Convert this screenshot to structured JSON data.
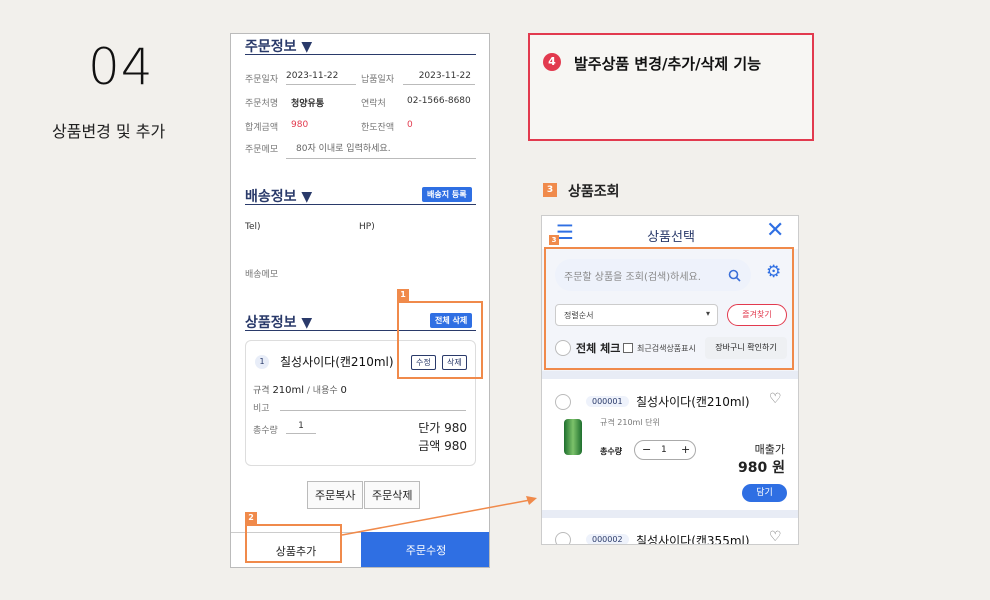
{
  "step": {
    "number": "04",
    "title": "상품변경 및 추가"
  },
  "left": {
    "order_info": {
      "title": "주문정보 ▼",
      "order_date_label": "주문일자",
      "order_date": "2023-11-22",
      "delivery_date_label": "납품일자",
      "delivery_date": "2023-11-22",
      "customer_label": "주문처명",
      "customer": "청양유통",
      "contact_label": "연락처",
      "contact": "02-1566-8680",
      "total_label": "합계금액",
      "total": "980",
      "limit_label": "한도잔액",
      "limit": "0",
      "memo_label": "주문메모",
      "memo_placeholder": "80자 이내로 입력하세요."
    },
    "shipping": {
      "title": "배송정보 ▼",
      "register_button": "배송지 등록",
      "tel_label": "Tel)",
      "hp_label": "HP)",
      "memo_label": "배송메모"
    },
    "products": {
      "title": "상품정보 ▼",
      "delete_all_button": "전체 삭제",
      "item": {
        "index": "1",
        "name": "칠성사이다(캔210ml)",
        "edit_button": "수정",
        "delete_button": "삭제",
        "spec_label": "규격",
        "spec_value": "210ml",
        "unit_sep": " / 내용수",
        "unit_value": "0",
        "note_label": "비고",
        "qty_label": "총수량",
        "qty_value": "1",
        "unit_price": "단가 980",
        "amount": "금액 980"
      }
    },
    "copy_button": "주문복사",
    "delete_order_button": "주문삭제",
    "add_product_button": "상품추가",
    "modify_order_button": "주문수정",
    "badges": [
      "1",
      "2"
    ]
  },
  "feature": {
    "number": "4",
    "title": "발주상품 변경/추가/삭제 기능"
  },
  "lookup": {
    "number": "3",
    "title": "상품조회"
  },
  "right": {
    "header_title": "상품선택",
    "search_placeholder": "주문할 상품을 조회(검색)하세요.",
    "sort_value": "정렬순서",
    "favorites_button": "즐겨찾기",
    "check_all_label": "전체 체크",
    "recent_label": "최근검색상품표시",
    "cart_button": "장바구니 확인하기",
    "badge": "3",
    "products": [
      {
        "code": "000001",
        "name": "칠성사이다(캔210ml)",
        "spec": "규격 210ml  단위",
        "qty_label": "총수량",
        "qty": "1",
        "price_label": "매출가",
        "price": "980 원",
        "add_button": "담기"
      },
      {
        "code": "000002",
        "name": "칠성사이다(캔355ml)"
      }
    ]
  },
  "colors": {
    "accent_red": "#e23a4e",
    "orange": "#f08a4b",
    "blue": "#2f6fe3",
    "navy": "#2a3a6a"
  }
}
